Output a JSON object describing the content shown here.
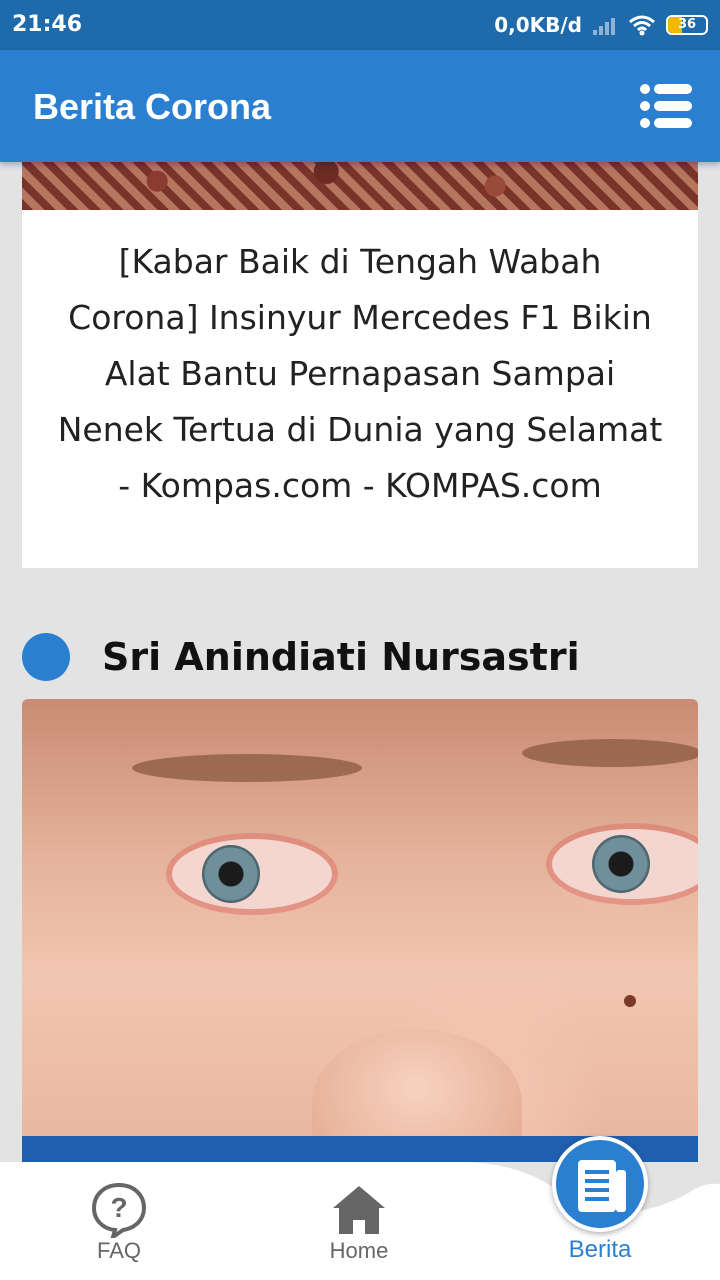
{
  "status_bar": {
    "time": "21:46",
    "network_speed": "0,0KB/d",
    "battery_level": "36",
    "battery_fraction": 0.36
  },
  "app_bar": {
    "title": "Berita Corona",
    "menu_icon": "list-menu-icon"
  },
  "news": {
    "top_card": {
      "title": "[Kabar Baik di Tengah Wabah Corona] Insinyur Mercedes F1 Bikin Alat Bantu Pernapasan Sampai Nenek Tertua di Dunia yang Selamat - Kompas.com - KOMPAS.com"
    },
    "next_item": {
      "author": "Sri Anindiati Nursastri"
    }
  },
  "bottom_nav": {
    "items": [
      {
        "label": "FAQ",
        "icon": "question-bubble-icon"
      },
      {
        "label": "Home",
        "icon": "home-icon"
      },
      {
        "label": "Berita",
        "icon": "newspaper-icon",
        "active": true
      }
    ]
  },
  "colors": {
    "status_bar": "#1f6aaa",
    "primary": "#2b7fd0",
    "background": "#e3e3e3",
    "inactive_nav": "#666666",
    "battery": "#f2b705"
  }
}
